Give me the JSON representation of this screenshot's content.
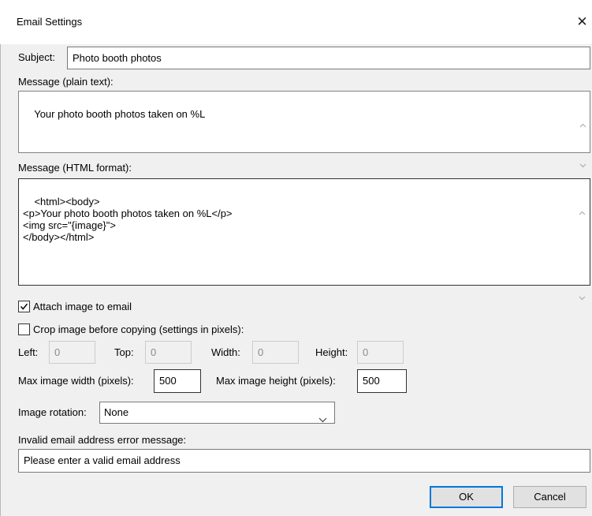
{
  "window": {
    "title": "Email Settings",
    "close_glyph": "✕"
  },
  "subject": {
    "label": "Subject:",
    "value": "Photo booth photos"
  },
  "message_plain": {
    "label": "Message (plain text):",
    "value": "Your photo booth photos taken on %L"
  },
  "message_html": {
    "label": "Message (HTML format):",
    "value": "<html><body>\n<p>Your photo booth photos taken on %L</p>\n<img src=\"{image}\">\n</body></html>"
  },
  "attach_image": {
    "label": "Attach image to email",
    "checked": true
  },
  "crop_image": {
    "label": "Crop image before copying (settings in pixels):",
    "checked": false
  },
  "crop": {
    "left_label": "Left:",
    "left_value": "0",
    "top_label": "Top:",
    "top_value": "0",
    "width_label": "Width:",
    "width_value": "0",
    "height_label": "Height:",
    "height_value": "0"
  },
  "max_width": {
    "label": "Max image width (pixels):",
    "value": "500"
  },
  "max_height": {
    "label": "Max image height (pixels):",
    "value": "500"
  },
  "rotation": {
    "label": "Image rotation:",
    "value": "None"
  },
  "invalid_email": {
    "label": "Invalid email address error message:",
    "value": "Please enter a valid email address"
  },
  "buttons": {
    "ok": "OK",
    "cancel": "Cancel"
  },
  "colors": {
    "accent": "#0078d7",
    "background": "#f0f0f0",
    "titlebar": "#ffffff"
  }
}
